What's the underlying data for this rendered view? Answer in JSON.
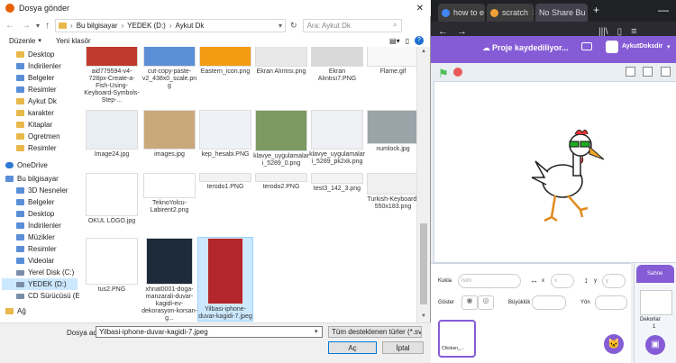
{
  "dialog": {
    "title": "Dosya gönder",
    "breadcrumb": [
      "Bu bilgisayar",
      "YEDEK (D:)",
      "Aykut Dk"
    ],
    "search_placeholder": "Ara: Aykut Dk",
    "toolbar": {
      "organize": "Düzenle",
      "new_folder": "Yeni klasör"
    },
    "nav_items": [
      {
        "label": "Desktop",
        "icon": "folder-blue-icon"
      },
      {
        "label": "İndirilenler",
        "icon": "download-icon"
      },
      {
        "label": "Belgeler",
        "icon": "documents-icon"
      },
      {
        "label": "Resimler",
        "icon": "pictures-icon"
      },
      {
        "label": "Aykut Dk",
        "icon": "folder-icon"
      },
      {
        "label": "karakter",
        "icon": "folder-icon"
      },
      {
        "label": "Kitaplar",
        "icon": "folder-icon"
      },
      {
        "label": "Ogretmen",
        "icon": "folder-icon"
      },
      {
        "label": "Resimler",
        "icon": "folder-icon"
      },
      {
        "label": "OneDrive",
        "icon": "cloud-icon"
      },
      {
        "label": "Bu bilgisayar",
        "icon": "computer-icon"
      },
      {
        "label": "3D Nesneler",
        "icon": "3d-objects-icon"
      },
      {
        "label": "Belgeler",
        "icon": "documents-icon"
      },
      {
        "label": "Desktop",
        "icon": "desktop-icon"
      },
      {
        "label": "İndirilenler",
        "icon": "download-icon"
      },
      {
        "label": "Müzikler",
        "icon": "music-icon"
      },
      {
        "label": "Resimler",
        "icon": "pictures-icon"
      },
      {
        "label": "Videolar",
        "icon": "videos-icon"
      },
      {
        "label": "Yerel Disk (C:)",
        "icon": "drive-icon"
      },
      {
        "label": "YEDEK (D:)",
        "icon": "drive-icon"
      },
      {
        "label": "CD Sürücüsü (E:)",
        "icon": "cd-drive-icon"
      },
      {
        "label": "Ağ",
        "icon": "network-icon"
      }
    ],
    "files": [
      {
        "name": "aid779594-v4-728px-Create-a-Fish-Using-Keyboard-Symbols-Step-...",
        "color": "#c0392b"
      },
      {
        "name": "cut-copy-paste-v2_438x0_scale.png",
        "color": "#5b8fd6"
      },
      {
        "name": "Eastern_icon.png",
        "color": "#f39c12"
      },
      {
        "name": "Ekran Alıntısı.png",
        "color": "#e8e8e8"
      },
      {
        "name": "Ekran Alıntısı7.PNG",
        "color": "#d8d8d8"
      },
      {
        "name": "Flame.gif",
        "color": "#f8f8f8"
      },
      {
        "name": "Image24.jpg",
        "color": "#e9eef5"
      },
      {
        "name": "images.jpg",
        "color": "#c9a87a"
      },
      {
        "name": "kep_hesabi.PNG",
        "color": "#eef2f8"
      },
      {
        "name": "klavye_uygulamalari_5289_0.png",
        "color": "#7d9a62"
      },
      {
        "name": "klavye_uygulamalari_5289_pk2xk.png",
        "color": "#eef0f4"
      },
      {
        "name": "numlock.jpg",
        "color": "#9aa3a8"
      },
      {
        "name": "OKUL LOGO.jpg",
        "color": "#ffffff"
      },
      {
        "name": "TeknoYolcu-Labirent2.png",
        "color": "#ffffff"
      },
      {
        "name": "terodo1.PNG",
        "color": "#f2f2f2"
      },
      {
        "name": "terodo2.PNG",
        "color": "#f2f2f2"
      },
      {
        "name": "test3_142_3.png",
        "color": "#f4f4f4"
      },
      {
        "name": "Turkish-Keyboard-550x183.png",
        "color": "#f0f0f0"
      },
      {
        "name": "tus2.PNG",
        "color": "#ffffff"
      },
      {
        "name": "xhnat0001-doga-manzarali-duvar-kagidi-ev-dekorasyon-korsan-g...",
        "color": "#1d2b3a"
      },
      {
        "name": "Yilbasi-iphone-duvar-kagidi-7.jpeg",
        "color": "#b3262b"
      }
    ],
    "filename_label": "Dosya adı:",
    "filename_value": "Yilbasi-iphone-duvar-kagidi-7.jpeg",
    "filetype_value": "Tüm desteklenen türler (*.svg;*",
    "open_button": "Aç",
    "cancel_button": "İptal",
    "title_close": "✕"
  },
  "browser": {
    "tabs": [
      {
        "label": "how to e"
      },
      {
        "label": "scratch"
      },
      {
        "label": "No Share Bu"
      }
    ],
    "new_tab": "+",
    "minimize": "—"
  },
  "scratch": {
    "saving_text": "Proje kaydediliyor...",
    "username": "AykutDoksdir",
    "sprite_label": "Kukla",
    "sprite_placeholder": "İsim",
    "x_label": "x",
    "y_label": "y",
    "x_placeholder": "x",
    "y_placeholder": "y",
    "show_label": "Göster",
    "size_label": "Büyüklük",
    "direction_label": "Yön",
    "sprite_name": "Chicken_...",
    "stage_label": "Sahne",
    "backdrops_label": "Dekorlar",
    "backdrop_count": "1"
  }
}
